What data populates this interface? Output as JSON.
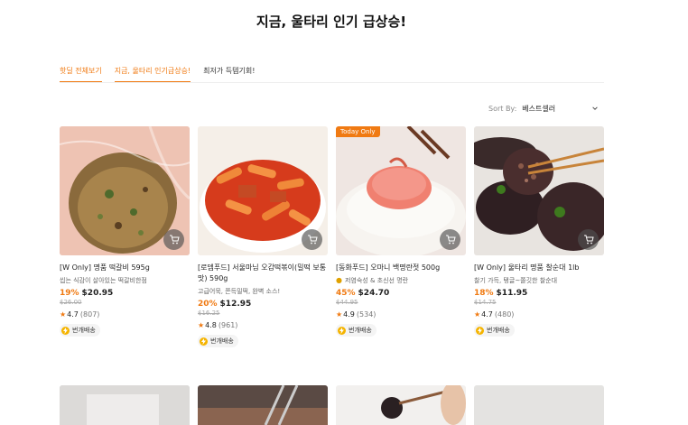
{
  "page": {
    "title": "지금, 울타리 인기 급상승!"
  },
  "tabs": [
    {
      "label": "핫딜 전체보기",
      "active": true
    },
    {
      "label": "지금, 울타리 인기급상승!",
      "active": true
    },
    {
      "label": "최저가 득템기회!",
      "active": false
    }
  ],
  "sort": {
    "label": "Sort By:",
    "value": "베스트셀러"
  },
  "colors": {
    "accent": "#f07a12",
    "badge": "#f07a12"
  },
  "products": [
    {
      "name": "[W Only] 명품 떡갈비 595g",
      "desc": "씹는 식감이 살아있는 떡갈비한점",
      "discount": "19%",
      "price": "$20.95",
      "original": "$26.00",
      "rating": "4.7",
      "reviews": "(807)",
      "shipping": "번개배송"
    },
    {
      "name": "[로뎀푸드] 서울마님 오감떡볶이(밀떡 보통맛) 590g",
      "desc": "고급어묵, 쫀득밀떡, 완벽 소스!",
      "discount": "20%",
      "price": "$12.95",
      "original": "$16.25",
      "rating": "4.8",
      "reviews": "(961)",
      "shipping": "번개배송"
    },
    {
      "name": "[동화푸드] 오마니 백명란젓 500g",
      "desc": "저염숙성 & 초신선 명란",
      "discount": "45%",
      "price": "$24.70",
      "original": "$44.95",
      "rating": "4.9",
      "reviews": "(534)",
      "shipping": "번개배송",
      "badge": "Today Only"
    },
    {
      "name": "[W Only] 울타리 명품 찰순대 1lb",
      "desc": "찰기 가득, 탱글~쫄깃한 찰순대",
      "discount": "18%",
      "price": "$11.95",
      "original": "$14.75",
      "rating": "4.7",
      "reviews": "(480)",
      "shipping": "번개배송"
    }
  ]
}
